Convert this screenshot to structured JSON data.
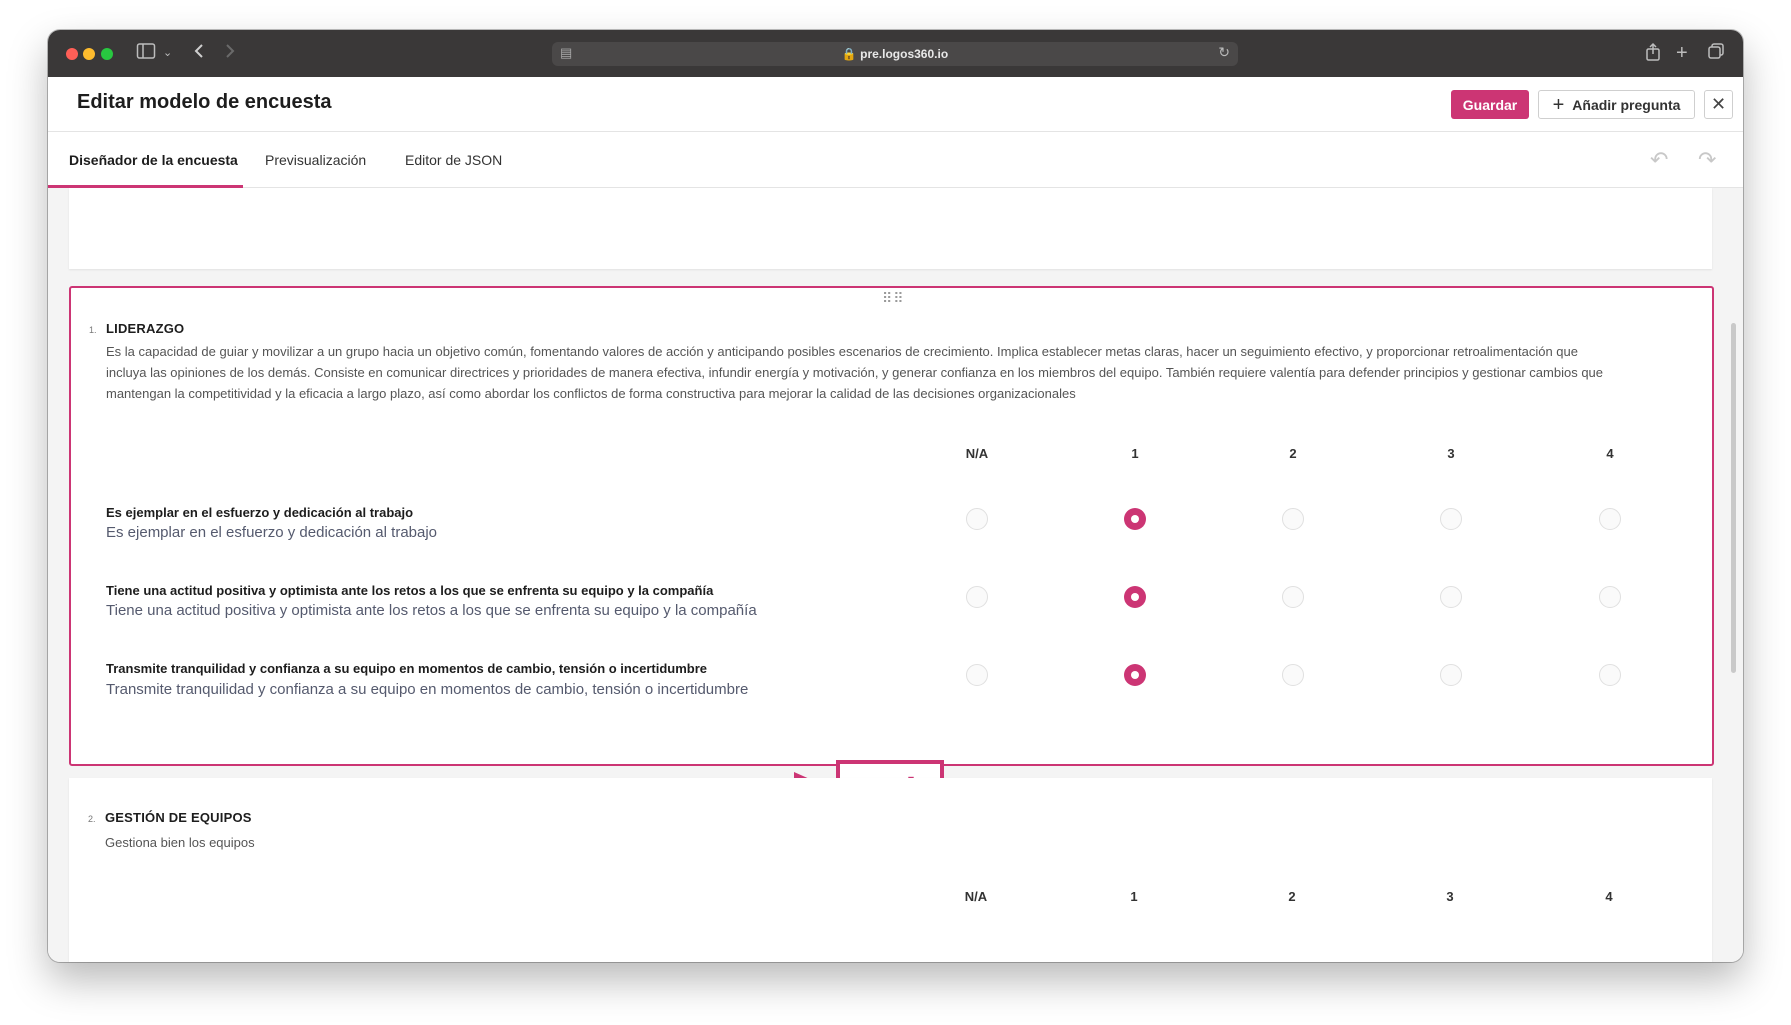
{
  "browser": {
    "url": "pre.logos360.io"
  },
  "header": {
    "title": "Editar modelo de encuesta",
    "save_label": "Guardar",
    "add_question_label": "Añadir pregunta"
  },
  "tabs": [
    {
      "label": "Diseñador de la encuesta",
      "active": true
    },
    {
      "label": "Previsualización",
      "active": false
    },
    {
      "label": "Editor de JSON",
      "active": false
    }
  ],
  "columns": [
    "N/A",
    "1",
    "2",
    "3",
    "4"
  ],
  "questions": [
    {
      "number": "1.",
      "title": "LIDERAZGO",
      "description_lines": [
        "Es la capacidad de guiar y movilizar a un grupo hacia un objetivo común, fomentando valores de acción y anticipando posibles escenarios de crecimiento. Implica establecer metas claras, hacer un seguimiento efectivo, y proporcionar retroalimentación que",
        "incluya las opiniones de los demás. Consiste en comunicar directrices y prioridades de manera efectiva, infundir energía y motivación, y generar confianza en los miembros del equipo. También requiere valentía para defender principios y gestionar cambios que",
        "mantengan la competitividad y la eficacia a largo plazo, así como abordar los conflictos de forma constructiva para mejorar la calidad de las decisiones organizacionales"
      ],
      "rows": [
        {
          "title": "Es ejemplar en el esfuerzo y dedicación al trabajo",
          "subtitle": "Es ejemplar en el esfuerzo y dedicación al trabajo",
          "selected": "1"
        },
        {
          "title": "Tiene una actitud positiva y optimista ante los retos  a los que se enfrenta su equipo y  la compañía",
          "subtitle": "Tiene una actitud positiva y optimista ante los retos  a los que se enfrenta su equipo y  la compañía",
          "selected": "1"
        },
        {
          "title": "Transmite tranquilidad y confianza a su equipo en momentos de cambio, tensión o incertidumbre",
          "subtitle": "Transmite tranquilidad y confianza a su equipo en momentos de cambio, tensión o incertidumbre",
          "selected": "1"
        }
      ]
    },
    {
      "number": "2.",
      "title": "GESTIÓN DE EQUIPOS",
      "description_lines": [
        "Gestiona bien los equipos"
      ]
    }
  ],
  "icons": {
    "edit": "pencil-icon",
    "delete": "trash-icon",
    "drag": "drag-handle-icon"
  },
  "colors": {
    "accent": "#cc3574",
    "chrome": "#3a3838"
  }
}
